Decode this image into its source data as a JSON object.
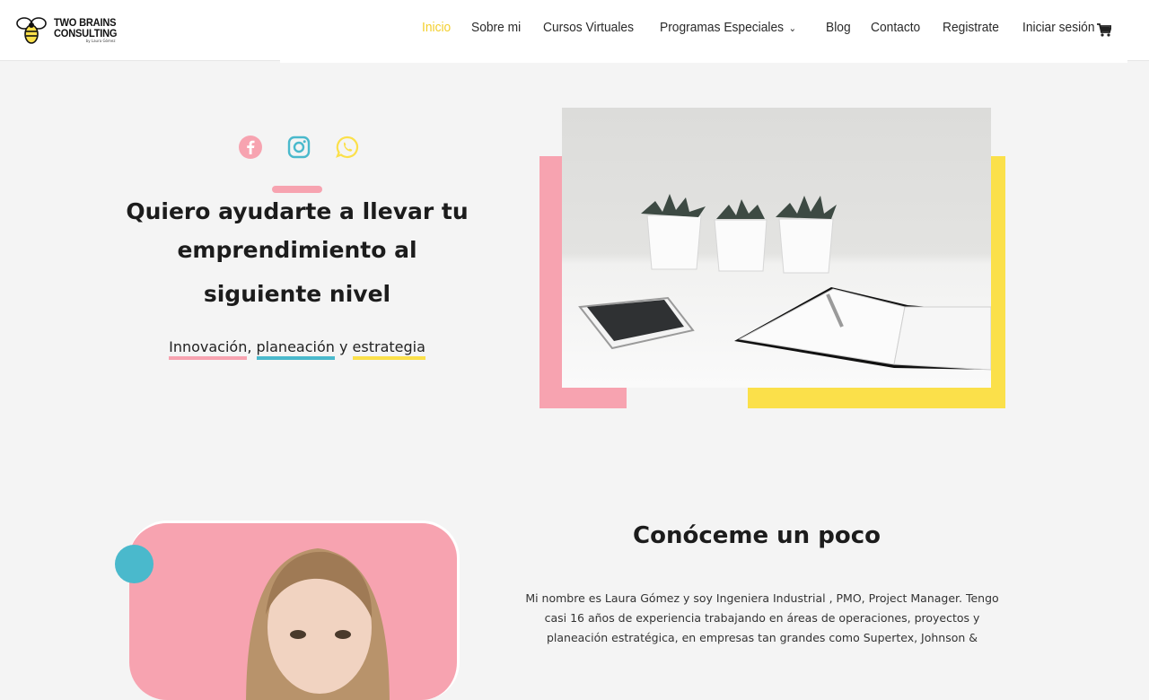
{
  "brand": {
    "logo_line1": "TWO BRAINS",
    "logo_line2": "CONSULTING",
    "logo_sub": "by Laura Gómez",
    "icon": "bee-logo-icon",
    "accent_yellow": "#fbe04a",
    "accent_pink": "#f7a3b0",
    "accent_blue": "#4ab9cc"
  },
  "nav": {
    "items": [
      {
        "label": "Inicio",
        "active": true
      },
      {
        "label": "Sobre mi"
      },
      {
        "label": "Cursos Virtuales"
      },
      {
        "label": "Programas Especiales",
        "has_dropdown": true
      },
      {
        "label": "Blog"
      },
      {
        "label": "Contacto"
      },
      {
        "label": "Registrate"
      },
      {
        "label": "Iniciar sesión"
      }
    ],
    "cart_icon": "shopping-cart-icon"
  },
  "hero": {
    "social": [
      "facebook-icon",
      "instagram-icon",
      "whatsapp-icon"
    ],
    "title_lines": [
      "Quiero ayudarte a llevar tu",
      "emprendimiento al",
      "siguiente nivel"
    ],
    "tagline": {
      "w1": "Innovación",
      "sep1": ",",
      "w2": "planeación",
      "sep2": "y",
      "w3": "estrategia"
    }
  },
  "about": {
    "title": "Conóceme un poco",
    "lines": [
      "Mi nombre es Laura Gómez y soy Ingeniera Industrial , PMO, Project Manager. Tengo",
      "casi 16 años de experiencia trabajando en áreas de operaciones, proyectos y",
      "planeación estratégica, en empresas tan grandes como Supertex, Johnson &"
    ]
  }
}
